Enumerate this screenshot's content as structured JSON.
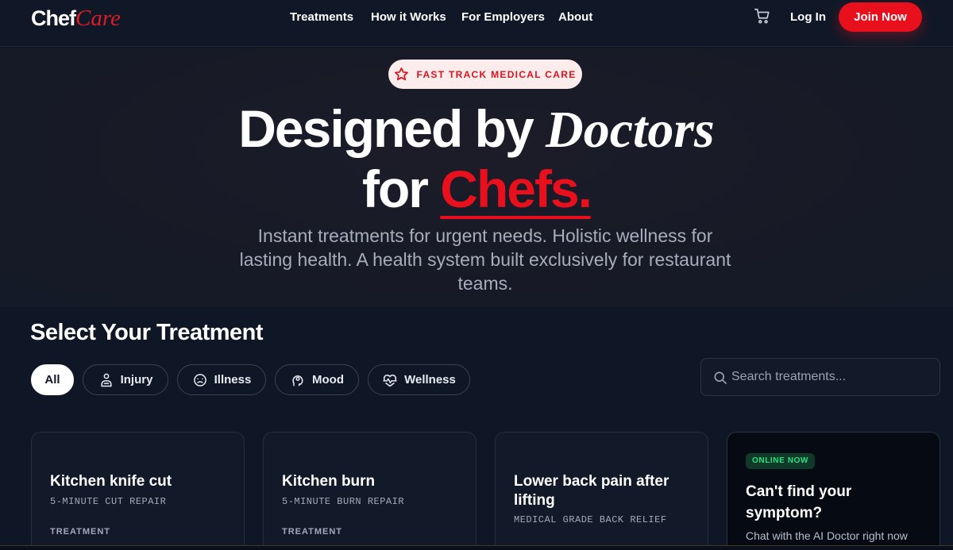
{
  "header": {
    "logo_part1": "Chef",
    "logo_part2": "Care",
    "nav": [
      "Treatments",
      "How it Works",
      "For Employers",
      "About"
    ],
    "cart_icon": "cart-icon",
    "login_label": "Log In",
    "join_label": "Join Now"
  },
  "hero": {
    "badge": "FAST TRACK MEDICAL CARE",
    "headline_1": "Designed by",
    "headline_1_italic": "Doctors",
    "headline_2": "for",
    "headline_2_red": "Chefs.",
    "subtitle": "Instant treatments for urgent needs. Holistic wellness for lasting health. A health system built exclusively for restaurant teams."
  },
  "treatments": {
    "title": "Select Your Treatment",
    "filters": [
      "All",
      "Injury",
      "Illness",
      "Mood",
      "Wellness"
    ],
    "search_placeholder": "Search treatments...",
    "cards": [
      {
        "title": "Kitchen knife cut",
        "subtitle": "5-MINUTE CUT REPAIR",
        "tag": "TREATMENT"
      },
      {
        "title": "Kitchen burn",
        "subtitle": "5-MINUTE BURN REPAIR",
        "tag": "TREATMENT"
      },
      {
        "title": "Lower back pain after lifting",
        "subtitle": "MEDICAL GRADE BACK RELIEF",
        "tag": ""
      }
    ],
    "ai_card": {
      "badge": "ONLINE NOW",
      "title": "Can't find your symptom?",
      "subtitle": "Chat with the AI Doctor right now"
    }
  },
  "colors": {
    "accent_red": "#e8101c",
    "background": "#0f1626",
    "online_green": "#2ee07e"
  }
}
